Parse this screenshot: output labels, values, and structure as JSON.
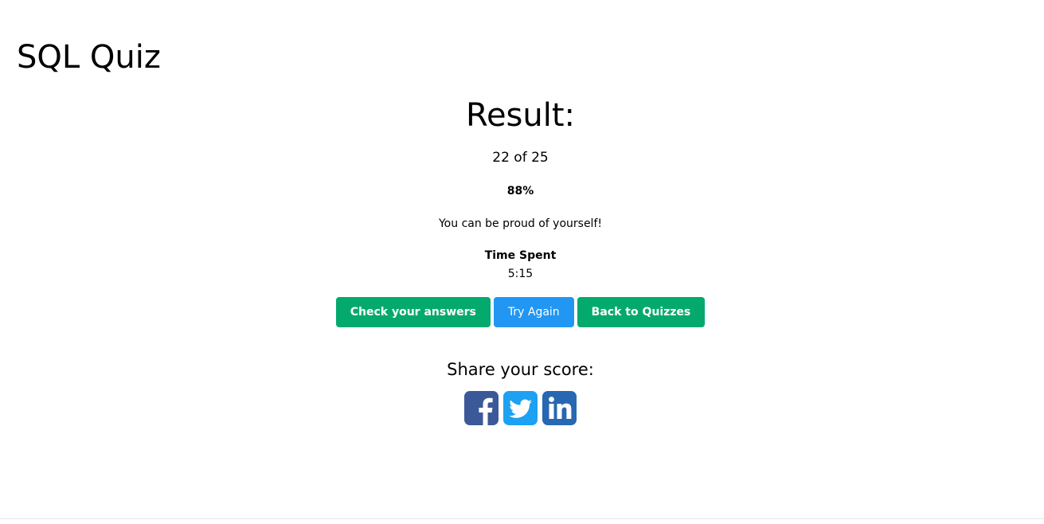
{
  "header": {
    "title": "SQL Quiz"
  },
  "result": {
    "heading": "Result:",
    "score_text": "22 of 25",
    "correct": 22,
    "total": 25,
    "percent": "88%",
    "message": "You can be proud of yourself!",
    "time_label": "Time Spent",
    "time_value": "5:15"
  },
  "actions": {
    "check_answers_label": "Check your answers",
    "try_again_label": "Try Again",
    "back_label": "Back to Quizzes"
  },
  "share": {
    "label": "Share your score:",
    "icons": [
      {
        "name": "facebook-icon",
        "color": "#3b5998"
      },
      {
        "name": "twitter-icon",
        "color": "#1da1f2"
      },
      {
        "name": "linkedin-icon",
        "color": "#2867b2"
      }
    ]
  },
  "colors": {
    "green_button": "#04aa6d",
    "blue_button": "#2196f3"
  }
}
